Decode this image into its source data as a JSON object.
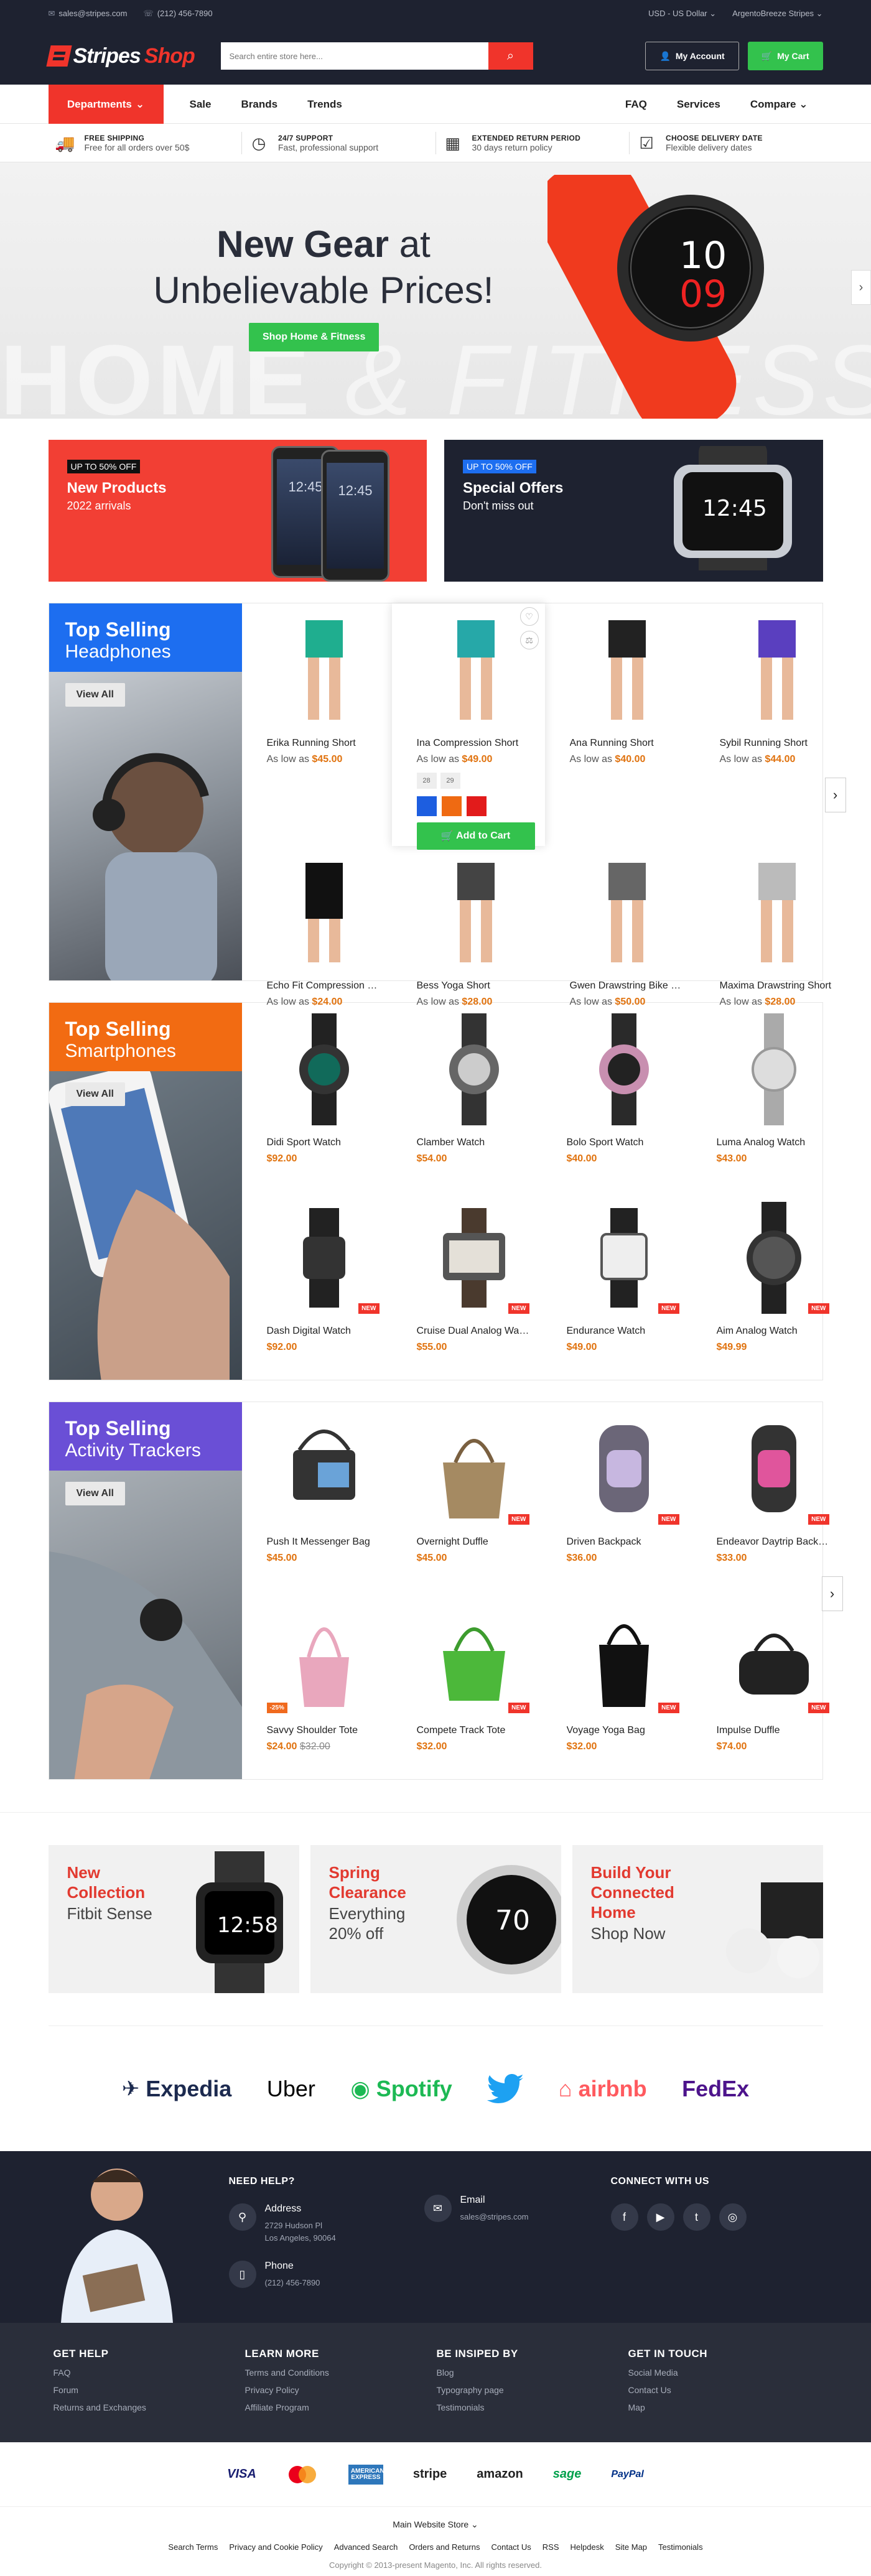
{
  "topbar": {
    "email": "sales@stripes.com",
    "phone": "(212) 456-7890",
    "currency": "USD - US Dollar",
    "store": "ArgentoBreeze Stripes"
  },
  "header": {
    "logo_a": "Stripes",
    "logo_b": "Shop",
    "search_placeholder": "Search entire store here...",
    "account": "My Account",
    "cart": "My Cart"
  },
  "nav": {
    "departments": "Departments",
    "links": [
      "Sale",
      "Brands",
      "Trends"
    ],
    "right": [
      "FAQ",
      "Services",
      "Compare"
    ]
  },
  "features": [
    {
      "title": "Free Shipping",
      "text": "Free for all orders over 50$",
      "icon": "truck-icon"
    },
    {
      "title": "24/7 Support",
      "text": "Fast, professional support",
      "icon": "clock-icon"
    },
    {
      "title": "Extended Return Period",
      "text": "30 days return policy",
      "icon": "calendar-icon"
    },
    {
      "title": "Choose Delivery Date",
      "text": "Flexible delivery dates",
      "icon": "calendar-check-icon"
    }
  ],
  "hero": {
    "line1_bold": "New Gear",
    "line1_rest": " at",
    "line2": "Unbelievable Prices!",
    "cta": "Shop Home & Fitness",
    "bg_a": "HOME",
    "bg_b": "& FITNESS",
    "watch_digits_a": "10",
    "watch_digits_b": "09"
  },
  "promos": [
    {
      "tag": "UP TO 50% OFF",
      "title": "New Products",
      "sub": "2022 arrivals"
    },
    {
      "tag": "UP TO 50% OFF",
      "title": "Special Offers",
      "sub": "Don't miss out"
    }
  ],
  "promo_screen_time": "12:45",
  "sections": [
    {
      "title_a": "Top Selling",
      "title_b": "Headphones",
      "color": "#1d6ef0",
      "view_all": "View All",
      "products": [
        {
          "name": "Erika Running Short",
          "prefix": "As low as ",
          "price": "$45.00"
        },
        {
          "name": "Ina Compression Short",
          "prefix": "As low as ",
          "price": "$49.00"
        },
        {
          "name": "Ana Running Short",
          "prefix": "As low as ",
          "price": "$40.00"
        },
        {
          "name": "Sybil Running Short",
          "prefix": "As low as ",
          "price": "$44.00"
        },
        {
          "name": "Echo Fit Compression Short",
          "prefix": "As low as ",
          "price": "$24.00"
        },
        {
          "name": "Bess Yoga Short",
          "prefix": "As low as ",
          "price": "$28.00"
        },
        {
          "name": "Gwen Drawstring Bike Short",
          "prefix": "As low as ",
          "price": "$50.00"
        },
        {
          "name": "Maxima Drawstring Short",
          "prefix": "As low as ",
          "price": "$28.00"
        }
      ],
      "hover": {
        "sizes": [
          "28",
          "29"
        ],
        "colors": [
          "#1d5ee0",
          "#ef6a12",
          "#e21b1b"
        ],
        "add": "Add to Cart"
      }
    },
    {
      "title_a": "Top Selling",
      "title_b": "Smartphones",
      "color": "#f26b12",
      "view_all": "View All",
      "products": [
        {
          "name": "Didi Sport Watch",
          "prefix": "",
          "price": "$92.00"
        },
        {
          "name": "Clamber Watch",
          "prefix": "",
          "price": "$54.00"
        },
        {
          "name": "Bolo Sport Watch",
          "prefix": "",
          "price": "$40.00"
        },
        {
          "name": "Luma Analog Watch",
          "prefix": "",
          "price": "$43.00"
        },
        {
          "name": "Dash Digital Watch",
          "prefix": "",
          "price": "$92.00",
          "badge": "NEW"
        },
        {
          "name": "Cruise Dual Analog Watch",
          "prefix": "",
          "price": "$55.00",
          "badge": "NEW"
        },
        {
          "name": "Endurance Watch",
          "prefix": "",
          "price": "$49.00",
          "badge": "NEW"
        },
        {
          "name": "Aim Analog Watch",
          "prefix": "",
          "price": "$49.99",
          "badge": "NEW"
        }
      ]
    },
    {
      "title_a": "Top Selling",
      "title_b": "Activity Trackers",
      "color": "#6a4fd6",
      "view_all": "View All",
      "products": [
        {
          "name": "Push It Messenger Bag",
          "prefix": "",
          "price": "$45.00"
        },
        {
          "name": "Overnight Duffle",
          "prefix": "",
          "price": "$45.00",
          "badge": "NEW"
        },
        {
          "name": "Driven Backpack",
          "prefix": "",
          "price": "$36.00",
          "badge": "NEW"
        },
        {
          "name": "Endeavor Daytrip Backpack",
          "prefix": "",
          "price": "$33.00",
          "badge": "NEW"
        },
        {
          "name": "Savvy Shoulder Tote",
          "prefix": "",
          "price": "$24.00",
          "old": "$32.00",
          "sale": "-25%"
        },
        {
          "name": "Compete Track Tote",
          "prefix": "",
          "price": "$32.00",
          "badge": "NEW"
        },
        {
          "name": "Voyage Yoga Bag",
          "prefix": "",
          "price": "$32.00",
          "badge": "NEW"
        },
        {
          "name": "Impulse Duffle",
          "prefix": "",
          "price": "$74.00",
          "badge": "NEW"
        }
      ]
    }
  ],
  "banners": [
    {
      "title": "New Collection",
      "text": "Fitbit Sense",
      "screen": "12:58"
    },
    {
      "title": "Spring Clearance",
      "text": "Everything 20% off",
      "screen": "70"
    },
    {
      "title": "Build Your Connected Home",
      "text": "Shop Now"
    }
  ],
  "brands": [
    "Expedia",
    "Uber",
    "Spotify",
    "twitter-bird",
    "airbnb",
    "FedEx"
  ],
  "footer_help": {
    "need_help": "NEED HELP?",
    "address_label": "Address",
    "address": [
      "2729 Hudson Pl",
      "Los Angeles, 90064"
    ],
    "email_label": "Email",
    "email": "sales@stripes.com",
    "phone_label": "Phone",
    "phone": "(212) 456-7890",
    "connect": "CONNECT WITH US"
  },
  "footer_cols": [
    {
      "title": "GET HELP",
      "links": [
        "FAQ",
        "Forum",
        "Returns and Exchanges"
      ]
    },
    {
      "title": "LEARN MORE",
      "links": [
        "Terms and Conditions",
        "Privacy Policy",
        "Affiliate Program"
      ]
    },
    {
      "title": "BE INSIPED BY",
      "links": [
        "Blog",
        "Typography page",
        "Testimonials"
      ]
    },
    {
      "title": "GET IN TOUCH",
      "links": [
        "Social Media",
        "Contact Us",
        "Map"
      ]
    }
  ],
  "payments": [
    "VISA",
    "mastercard",
    "AMERICAN EXPRESS",
    "stripe",
    "amazon",
    "sage",
    "PayPal"
  ],
  "bottom": {
    "store": "Main Website Store",
    "links": [
      "Search Terms",
      "Privacy and Cookie Policy",
      "Advanced Search",
      "Orders and Returns",
      "Contact Us",
      "RSS",
      "Helpdesk",
      "Site Map",
      "Testimonials"
    ],
    "copyright": "Copyright © 2013-present Magento, Inc. All rights reserved."
  },
  "colors": {
    "accent": "#f0342b",
    "green": "#33c24d",
    "dark": "#1e2230",
    "price": "#e0720e"
  }
}
